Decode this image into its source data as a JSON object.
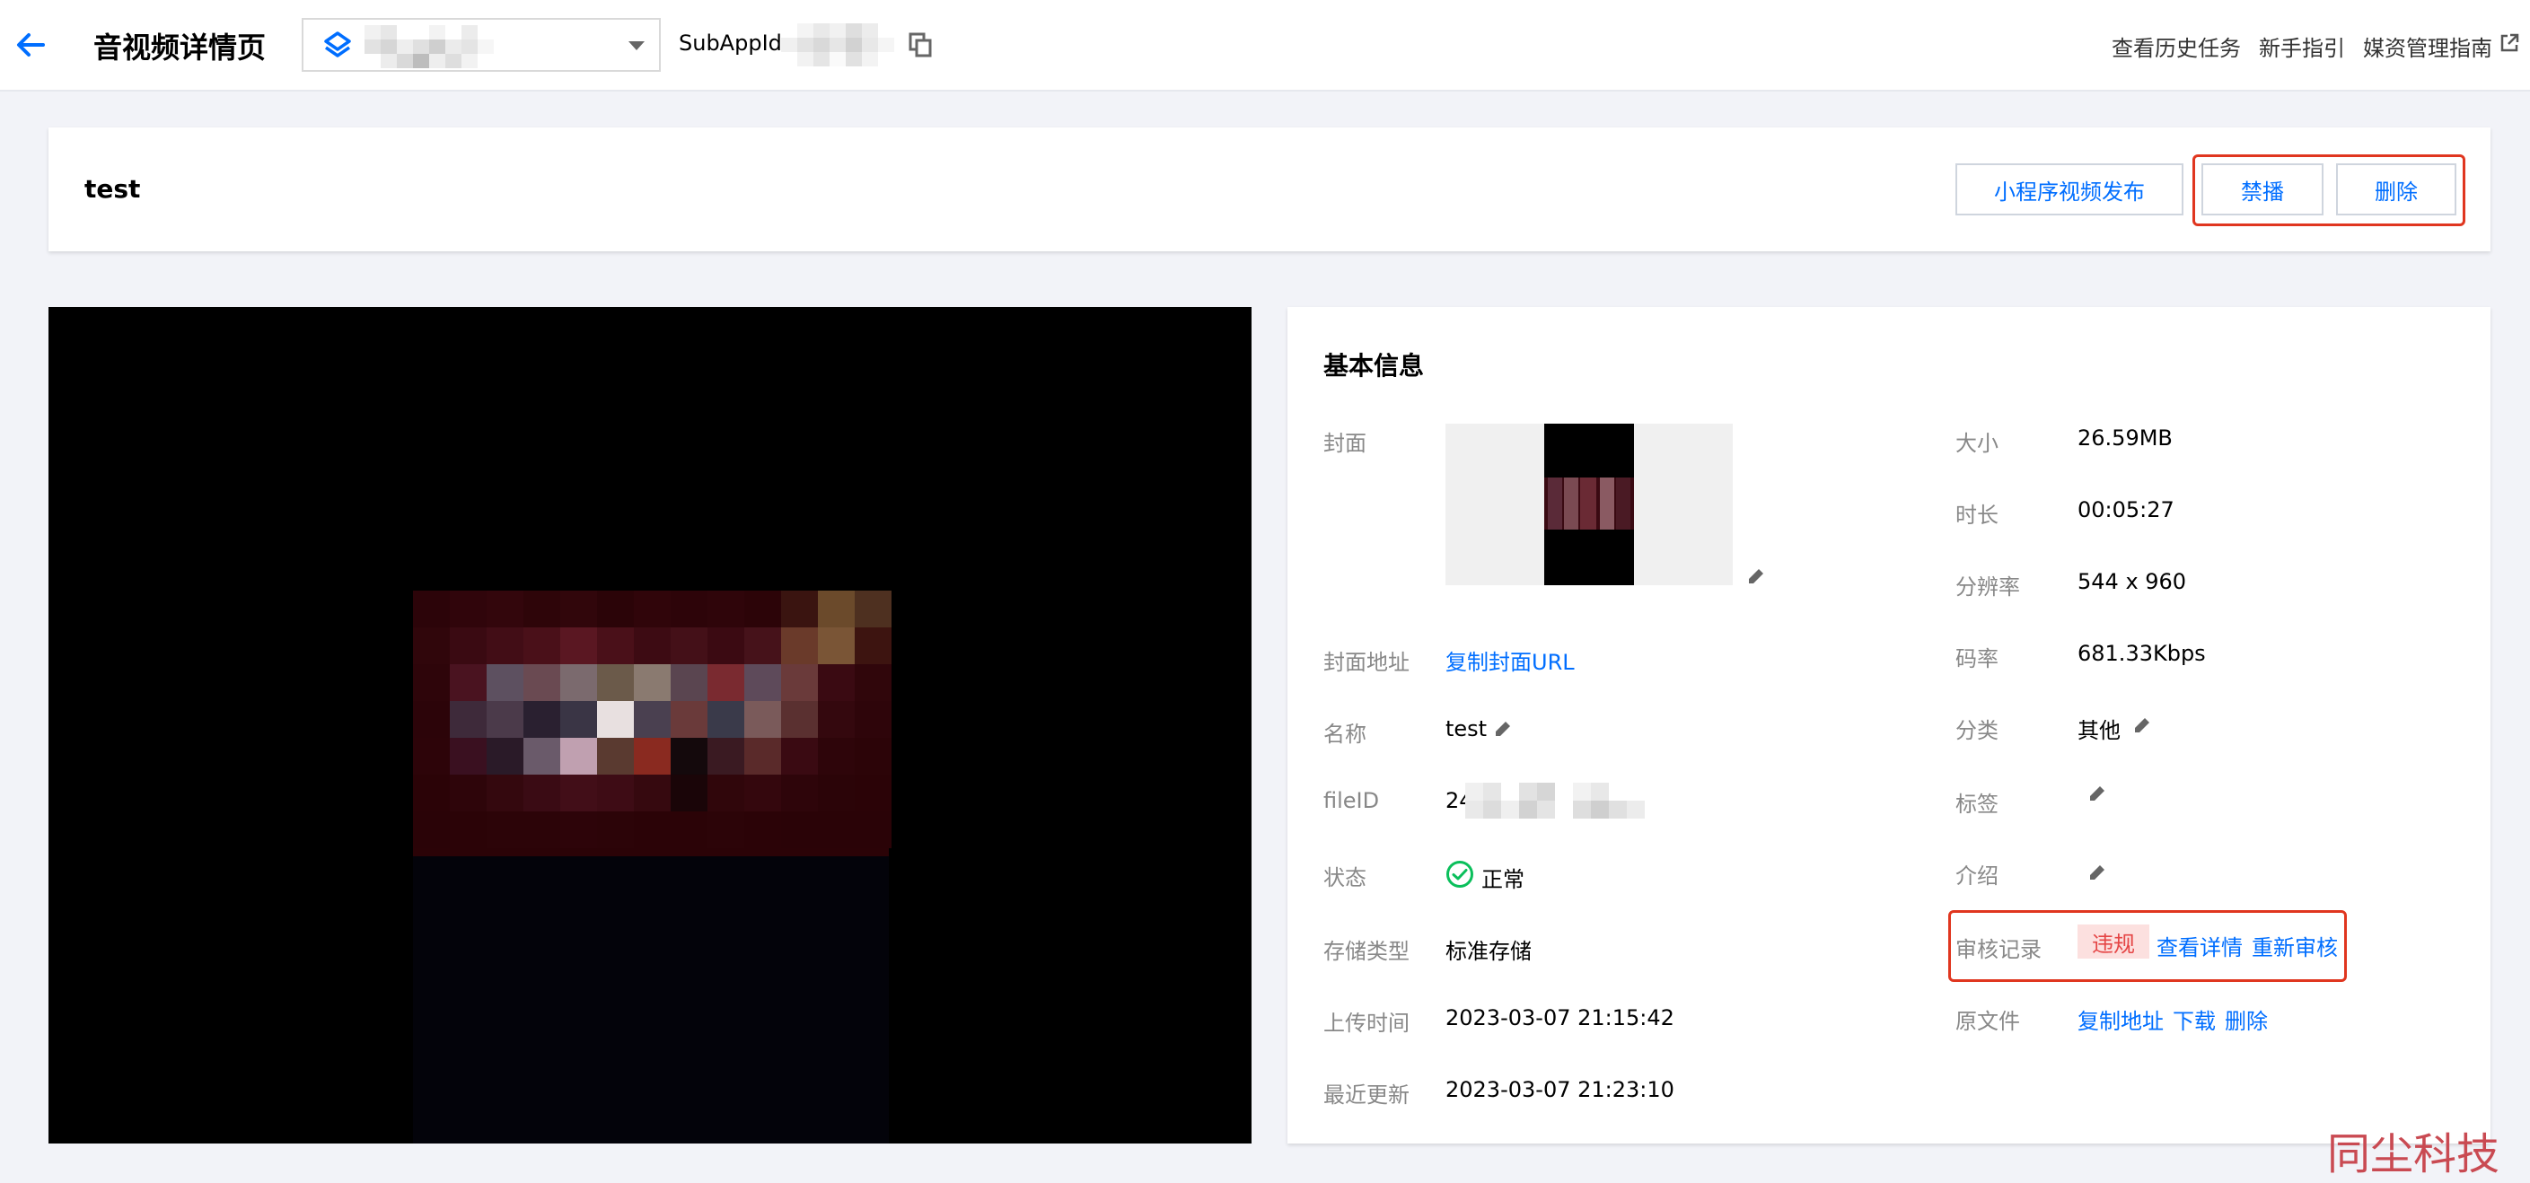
{
  "header": {
    "title": "音视频详情页",
    "subappid_label": "SubAppId:",
    "links": [
      "查看历史任务",
      "新手指引",
      "媒资管理指南"
    ]
  },
  "media": {
    "name": "test",
    "actions": [
      "小程序视频发布",
      "禁播",
      "删除"
    ]
  },
  "info": {
    "section_title": "基本信息",
    "labels": {
      "cover": "封面",
      "cover_url": "封面地址",
      "name": "名称",
      "fileid": "fileID",
      "status": "状态",
      "storage": "存储类型",
      "uploaded": "上传时间",
      "updated": "最近更新",
      "size": "大小",
      "duration": "时长",
      "resolution": "分辨率",
      "bitrate": "码率",
      "category": "分类",
      "tags": "标签",
      "intro": "介绍",
      "review": "审核记录",
      "original": "原文件"
    },
    "values": {
      "cover_url_link": "复制封面URL",
      "name": "test",
      "fileid_prefix": "24",
      "status": "正常",
      "storage": "标准存储",
      "uploaded": "2023-03-07 21:15:42",
      "updated": "2023-03-07 21:23:10",
      "size": "26.59MB",
      "duration": "00:05:27",
      "resolution": "544 x 960",
      "bitrate": "681.33Kbps",
      "category": "其他",
      "review_badge": "违规",
      "review_detail": "查看详情",
      "review_again": "重新审核",
      "original_copy": "复制地址",
      "original_download": "下载",
      "original_delete": "删除"
    }
  },
  "colors": {
    "accent": "#006eff",
    "highlight": "#e0361f",
    "success": "#0abf5b",
    "danger_bg": "#fce0df",
    "danger_text": "#e54545"
  },
  "watermark": "同尘科技"
}
